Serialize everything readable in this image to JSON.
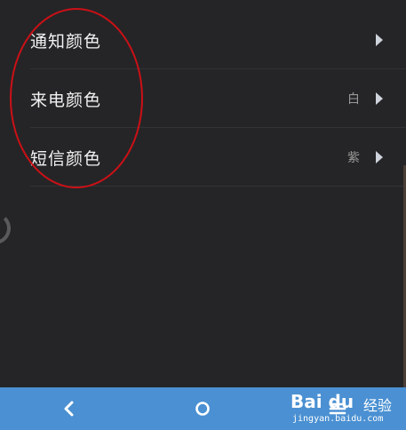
{
  "settings": {
    "items": [
      {
        "label": "通知颜色",
        "value": ""
      },
      {
        "label": "来电颜色",
        "value": "白"
      },
      {
        "label": "短信颜色",
        "value": "紫"
      }
    ]
  },
  "navbar": {
    "icons": [
      "back-icon",
      "home-icon",
      "menu-icon"
    ],
    "background": "#4a90d2"
  },
  "watermark": {
    "brand": "Bai du",
    "chinese": "经验",
    "url": "jingyan.baidu.com"
  },
  "colors": {
    "background": "#252527",
    "annotation": "#cc1016",
    "label": "#f2f2f2",
    "value": "#9a9a9a"
  }
}
